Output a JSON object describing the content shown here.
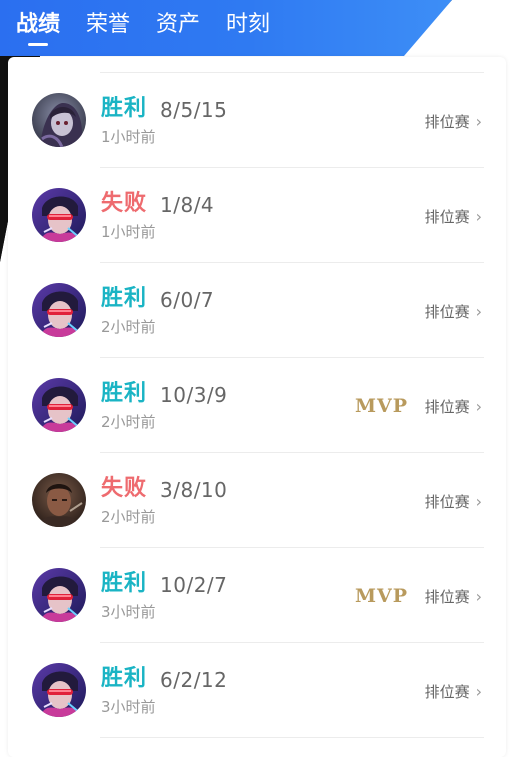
{
  "tabs": [
    {
      "label": "战绩",
      "active": true
    },
    {
      "label": "荣誉",
      "active": false
    },
    {
      "label": "资产",
      "active": false
    },
    {
      "label": "时刻",
      "active": false
    }
  ],
  "colors": {
    "header_blue": "#2b6ff0",
    "header_black": "#111111",
    "win": "#1ab4c4",
    "lose": "#ee6b6f",
    "mvp_gold": "#b89a5d"
  },
  "records": [
    {
      "result": "胜利",
      "outcome": "win",
      "kda": "8/5/15",
      "time": "1小时前",
      "mode": "排位赛",
      "mvp": "",
      "avatar": "hero-dark-hood"
    },
    {
      "result": "失败",
      "outcome": "lose",
      "kda": "1/8/4",
      "time": "1小时前",
      "mode": "排位赛",
      "mvp": "",
      "avatar": "hero-purple-visor"
    },
    {
      "result": "胜利",
      "outcome": "win",
      "kda": "6/0/7",
      "time": "2小时前",
      "mode": "排位赛",
      "mvp": "",
      "avatar": "hero-purple-visor"
    },
    {
      "result": "胜利",
      "outcome": "win",
      "kda": "10/3/9",
      "time": "2小时前",
      "mode": "排位赛",
      "mvp": "MVP",
      "avatar": "hero-purple-visor"
    },
    {
      "result": "失败",
      "outcome": "lose",
      "kda": "3/8/10",
      "time": "2小时前",
      "mode": "排位赛",
      "mvp": "",
      "avatar": "hero-dark-warrior"
    },
    {
      "result": "胜利",
      "outcome": "win",
      "kda": "10/2/7",
      "time": "3小时前",
      "mode": "排位赛",
      "mvp": "MVP",
      "avatar": "hero-purple-visor"
    },
    {
      "result": "胜利",
      "outcome": "win",
      "kda": "6/2/12",
      "time": "3小时前",
      "mode": "排位赛",
      "mvp": "",
      "avatar": "hero-purple-visor"
    }
  ]
}
